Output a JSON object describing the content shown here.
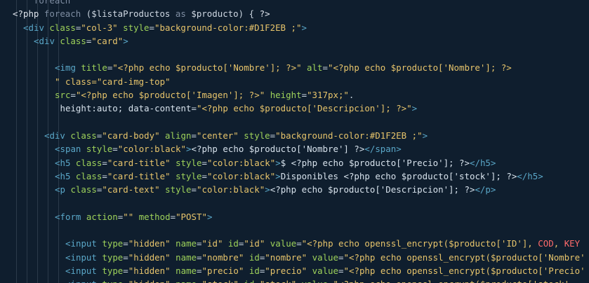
{
  "theme": {
    "background": "#0f1e2e",
    "tag": "#5aa7c8",
    "attribute": "#9ed25a",
    "string": "#e7c46b",
    "php_keyword": "#7f8ea3",
    "constant": "#ff6b6b"
  },
  "lines": [
    {
      "indent": 0,
      "tokens": [
        [
          "kw",
          "    foreach"
        ]
      ]
    },
    {
      "indent": 0,
      "tokens": [
        [
          "php",
          "<?php"
        ],
        [
          "kw",
          " foreach "
        ],
        [
          "punct",
          "("
        ],
        [
          "var",
          "$listaProductos"
        ],
        [
          "kw",
          " as "
        ],
        [
          "var",
          "$producto"
        ],
        [
          "punct",
          ") { "
        ],
        [
          "php",
          "?>"
        ]
      ]
    },
    {
      "indent": 1,
      "tokens": [
        [
          "tag",
          "<div"
        ],
        [
          "attr",
          " class"
        ],
        [
          "punct",
          "="
        ],
        [
          "str",
          "\"col-3\""
        ],
        [
          "attr",
          " style"
        ],
        [
          "punct",
          "="
        ],
        [
          "str",
          "\"background-color:#D1F2EB ;\""
        ],
        [
          "tag",
          ">"
        ]
      ]
    },
    {
      "indent": 2,
      "tokens": [
        [
          "tag",
          "<div"
        ],
        [
          "attr",
          " class"
        ],
        [
          "punct",
          "="
        ],
        [
          "str",
          "\"card\""
        ],
        [
          "tag",
          ">"
        ]
      ]
    },
    {
      "indent": 0,
      "tokens": []
    },
    {
      "indent": 3,
      "tokens": [
        [
          "tag",
          "<img"
        ],
        [
          "attr",
          " title"
        ],
        [
          "punct",
          "="
        ],
        [
          "str",
          "\"<?php echo $producto['Nombre']; ?>\""
        ],
        [
          "attr",
          " alt"
        ],
        [
          "punct",
          "="
        ],
        [
          "str",
          "\"<?php echo $producto['Nombre']; ?>"
        ]
      ]
    },
    {
      "indent": 3,
      "tokens": [
        [
          "str",
          "\" class=\"card-img-top\""
        ]
      ]
    },
    {
      "indent": 3,
      "tokens": [
        [
          "attr",
          "src"
        ],
        [
          "punct",
          "="
        ],
        [
          "str",
          "\"<?php echo $producto['Imagen']; ?>\""
        ],
        [
          "attr",
          " height"
        ],
        [
          "punct",
          "="
        ],
        [
          "str",
          "\"317px;\""
        ],
        [
          "punct",
          "."
        ]
      ]
    },
    {
      "indent": 3,
      "tokens": [
        [
          "plain",
          " height:auto; data-content"
        ],
        [
          "punct",
          "="
        ],
        [
          "str",
          "\"<?php echo $producto['Descripcion']; ?>\""
        ],
        [
          "tag",
          ">"
        ]
      ]
    },
    {
      "indent": 0,
      "tokens": []
    },
    {
      "indent": 2,
      "tokens": [
        [
          "plain",
          "  "
        ],
        [
          "tag",
          "<div"
        ],
        [
          "attr",
          " class"
        ],
        [
          "punct",
          "="
        ],
        [
          "str",
          "\"card-body\""
        ],
        [
          "attr",
          " align"
        ],
        [
          "punct",
          "="
        ],
        [
          "str",
          "\"center\""
        ],
        [
          "attr",
          " style"
        ],
        [
          "punct",
          "="
        ],
        [
          "str",
          "\"background-color:#D1F2EB ;\""
        ],
        [
          "tag",
          ">"
        ]
      ]
    },
    {
      "indent": 3,
      "tokens": [
        [
          "tag",
          "<span"
        ],
        [
          "attr",
          " style"
        ],
        [
          "punct",
          "="
        ],
        [
          "str",
          "\"color:black\""
        ],
        [
          "tag",
          ">"
        ],
        [
          "plain",
          "<?php echo $producto['Nombre'] ?>"
        ],
        [
          "tag",
          "</span>"
        ]
      ]
    },
    {
      "indent": 3,
      "tokens": [
        [
          "tag",
          "<h5"
        ],
        [
          "attr",
          " class"
        ],
        [
          "punct",
          "="
        ],
        [
          "str",
          "\"card-title\""
        ],
        [
          "attr",
          " style"
        ],
        [
          "punct",
          "="
        ],
        [
          "str",
          "\"color:black\""
        ],
        [
          "tag",
          ">"
        ],
        [
          "plain",
          "$ <?php echo $producto['Precio']; ?>"
        ],
        [
          "tag",
          "</h5>"
        ]
      ]
    },
    {
      "indent": 3,
      "tokens": [
        [
          "tag",
          "<h5"
        ],
        [
          "attr",
          " class"
        ],
        [
          "punct",
          "="
        ],
        [
          "str",
          "\"card-title\""
        ],
        [
          "attr",
          " style"
        ],
        [
          "punct",
          "="
        ],
        [
          "str",
          "\"color:black\""
        ],
        [
          "tag",
          ">"
        ],
        [
          "plain",
          "Disponibles <?php echo $producto['stock']; ?>"
        ],
        [
          "tag",
          "</h5>"
        ]
      ]
    },
    {
      "indent": 3,
      "tokens": [
        [
          "tag",
          "<p"
        ],
        [
          "attr",
          " class"
        ],
        [
          "punct",
          "="
        ],
        [
          "str",
          "\"card-text\""
        ],
        [
          "attr",
          " style"
        ],
        [
          "punct",
          "="
        ],
        [
          "str",
          "\"color:black\""
        ],
        [
          "tag",
          ">"
        ],
        [
          "plain",
          "<?php echo $producto['Descripcion']; ?>"
        ],
        [
          "tag",
          "</p>"
        ]
      ]
    },
    {
      "indent": 0,
      "tokens": []
    },
    {
      "indent": 3,
      "tokens": [
        [
          "tag",
          "<form"
        ],
        [
          "attr",
          " action"
        ],
        [
          "punct",
          "="
        ],
        [
          "str",
          "\"\""
        ],
        [
          "attr",
          " method"
        ],
        [
          "punct",
          "="
        ],
        [
          "str",
          "\"POST\""
        ],
        [
          "tag",
          ">"
        ]
      ]
    },
    {
      "indent": 0,
      "tokens": []
    },
    {
      "indent": 4,
      "tokens": [
        [
          "tag",
          "<input"
        ],
        [
          "attr",
          " type"
        ],
        [
          "punct",
          "="
        ],
        [
          "str",
          "\"hidden\""
        ],
        [
          "attr",
          " name"
        ],
        [
          "punct",
          "="
        ],
        [
          "str",
          "\"id\""
        ],
        [
          "attr",
          " id"
        ],
        [
          "punct",
          "="
        ],
        [
          "str",
          "\"id\""
        ],
        [
          "attr",
          " value"
        ],
        [
          "punct",
          "="
        ],
        [
          "str",
          "\"<?php echo openssl_encrypt($producto['ID'], "
        ],
        [
          "const",
          "COD"
        ],
        [
          "str",
          ", "
        ],
        [
          "const",
          "KEY"
        ]
      ]
    },
    {
      "indent": 4,
      "tokens": [
        [
          "tag",
          "<input"
        ],
        [
          "attr",
          " type"
        ],
        [
          "punct",
          "="
        ],
        [
          "str",
          "\"hidden\""
        ],
        [
          "attr",
          " name"
        ],
        [
          "punct",
          "="
        ],
        [
          "str",
          "\"nombre\""
        ],
        [
          "attr",
          " id"
        ],
        [
          "punct",
          "="
        ],
        [
          "str",
          "\"nombre\""
        ],
        [
          "attr",
          " value"
        ],
        [
          "punct",
          "="
        ],
        [
          "str",
          "\"<?php echo openssl_encrypt($producto['Nombre'"
        ]
      ]
    },
    {
      "indent": 4,
      "tokens": [
        [
          "tag",
          "<input"
        ],
        [
          "attr",
          " type"
        ],
        [
          "punct",
          "="
        ],
        [
          "str",
          "\"hidden\""
        ],
        [
          "attr",
          " name"
        ],
        [
          "punct",
          "="
        ],
        [
          "str",
          "\"precio\""
        ],
        [
          "attr",
          " id"
        ],
        [
          "punct",
          "="
        ],
        [
          "str",
          "\"precio\""
        ],
        [
          "attr",
          " value"
        ],
        [
          "punct",
          "="
        ],
        [
          "str",
          "\"<?php echo openssl_encrypt($producto['Precio'"
        ]
      ]
    },
    {
      "indent": 4,
      "tokens": [
        [
          "tag",
          "<input"
        ],
        [
          "attr",
          " type"
        ],
        [
          "punct",
          "="
        ],
        [
          "str",
          "\"hidden\""
        ],
        [
          "attr",
          " name"
        ],
        [
          "punct",
          "="
        ],
        [
          "str",
          "\"stock\""
        ],
        [
          "attr",
          " id"
        ],
        [
          "punct",
          "="
        ],
        [
          "str",
          "\"stock\""
        ],
        [
          "attr",
          " value"
        ],
        [
          "punct",
          "="
        ],
        [
          "str",
          "\"<?php echo openssl_encrypt($producto['stock'"
        ]
      ]
    }
  ]
}
